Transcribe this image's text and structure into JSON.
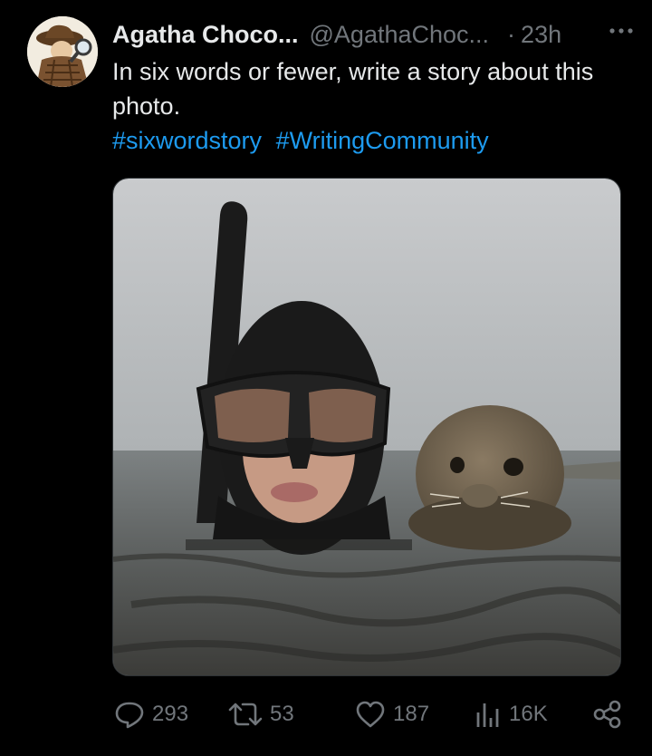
{
  "post": {
    "display_name": "Agatha Choco...",
    "handle": "@AgathaChoc...",
    "separator": "·",
    "time": "23h",
    "text": "In six words or fewer, write a story about this photo.",
    "hashtags": [
      "#sixwordstory",
      "#WritingCommunity"
    ]
  },
  "actions": {
    "replies": "293",
    "reposts": "53",
    "likes": "187",
    "views": "16K"
  },
  "icons": {
    "more": "more-icon",
    "reply": "reply-icon",
    "repost": "repost-icon",
    "like": "heart-icon",
    "views": "views-icon",
    "share": "share-icon"
  },
  "colors": {
    "background": "#000000",
    "text": "#e7e9ea",
    "muted": "#71767b",
    "link": "#1d9bf0"
  }
}
